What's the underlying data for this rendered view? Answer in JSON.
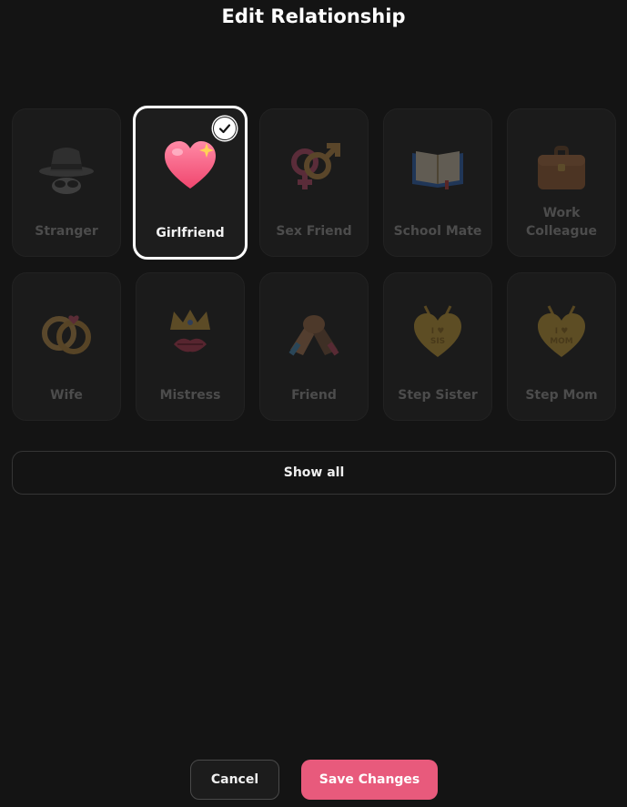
{
  "header": {
    "title": "Edit Relationship"
  },
  "relationships": [
    {
      "label": "Stranger",
      "icon": "spy-icon",
      "selected": false
    },
    {
      "label": "Girlfriend",
      "icon": "sparkling-heart-icon",
      "selected": true
    },
    {
      "label": "Sex Friend",
      "icon": "gender-symbols-icon",
      "selected": false
    },
    {
      "label": "School Mate",
      "icon": "open-book-icon",
      "selected": false
    },
    {
      "label": "Work\nColleague",
      "icon": "briefcase-icon",
      "selected": false
    },
    {
      "label": "Wife",
      "icon": "wedding-rings-icon",
      "selected": false
    },
    {
      "label": "Mistress",
      "icon": "crown-lips-icon",
      "selected": false
    },
    {
      "label": "Friend",
      "icon": "handshake-icon",
      "selected": false
    },
    {
      "label": "Step Sister",
      "icon": "sis-heart-pendant-icon",
      "selected": false
    },
    {
      "label": "Step Mom",
      "icon": "mom-heart-pendant-icon",
      "selected": false
    }
  ],
  "actions": {
    "show_all": "Show all",
    "cancel": "Cancel",
    "save": "Save Changes"
  },
  "colors": {
    "background": "#141414",
    "card": "#1b1b1b",
    "accent": "#e85a7c"
  }
}
